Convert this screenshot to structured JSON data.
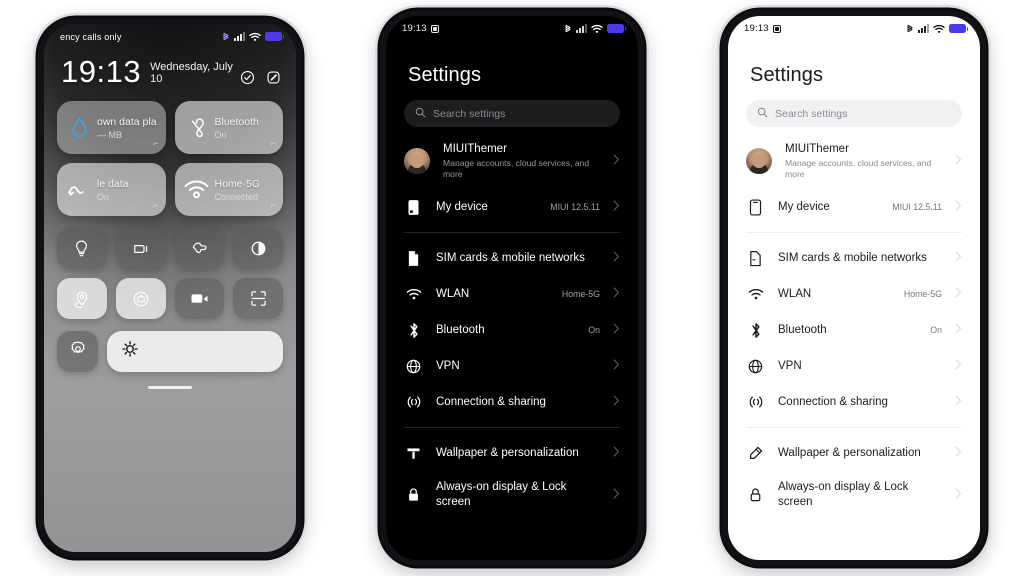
{
  "phone1": {
    "name": "control-center",
    "statusbar": {
      "carrier": "ency calls only",
      "icons": [
        "bluetooth-icon",
        "signal-icon",
        "wifi-icon",
        "battery-icon"
      ]
    },
    "clock": {
      "time": "19:13",
      "date": "Wednesday, July 10"
    },
    "header_icons": [
      "do-not-disturb-icon",
      "edit-icon"
    ],
    "big_tiles": [
      {
        "icon": "data-usage-icon",
        "title": "own data plan",
        "sub": "— MB",
        "state": "off"
      },
      {
        "icon": "bluetooth-icon",
        "title": "Bluetooth",
        "sub": "On",
        "state": "on"
      },
      {
        "icon": "mobile-data-icon",
        "title": "le data",
        "sub": "On",
        "state": "on"
      },
      {
        "icon": "wifi-icon",
        "title": "Home-5G",
        "sub": "Connected",
        "state": "on"
      }
    ],
    "tiles": [
      {
        "icon": "flashlight-icon",
        "state": "off"
      },
      {
        "icon": "vibrate-icon",
        "state": "off"
      },
      {
        "icon": "ringtone-icon",
        "state": "off"
      },
      {
        "icon": "dark-mode-icon",
        "state": "off"
      },
      {
        "icon": "location-icon",
        "state": "on"
      },
      {
        "icon": "screenshot-icon",
        "state": "on"
      },
      {
        "icon": "screen-recorder-icon",
        "state": "off"
      },
      {
        "icon": "scanner-icon",
        "state": "off"
      }
    ],
    "bottom": {
      "settings_icon": "settings-gear-icon",
      "brightness_icon": "brightness-icon"
    }
  },
  "phone2": {
    "name": "settings-dark",
    "statusbar": {
      "time": "19:13",
      "left_icon": "alarm-icon",
      "icons": [
        "bluetooth-icon",
        "signal-icon",
        "wifi-icon",
        "battery-icon"
      ]
    },
    "title": "Settings",
    "search": {
      "placeholder": "Search settings",
      "icon": "search-icon"
    },
    "rows": [
      {
        "icon": "avatar",
        "label": "MIUIThemer",
        "sub": "Manage accounts, cloud services, and more",
        "value": ""
      },
      {
        "icon": "my-device-icon",
        "label": "My device",
        "value": "MIUI 12.5.11"
      },
      {
        "icon": "sim-card-icon",
        "label": "SIM cards & mobile networks",
        "value": ""
      },
      {
        "icon": "wifi-icon",
        "label": "WLAN",
        "value": "Home-5G"
      },
      {
        "icon": "bluetooth-icon",
        "label": "Bluetooth",
        "value": "On"
      },
      {
        "icon": "vpn-icon",
        "label": "VPN",
        "value": ""
      },
      {
        "icon": "connection-sharing-icon",
        "label": "Connection & sharing",
        "value": ""
      },
      {
        "icon": "wallpaper-icon",
        "label": "Wallpaper & personalization",
        "value": ""
      },
      {
        "icon": "lock-icon",
        "label": "Always-on display & Lock screen",
        "value": ""
      }
    ]
  },
  "phone3": {
    "name": "settings-light",
    "statusbar": {
      "time": "19:13",
      "left_icon": "alarm-icon",
      "icons": [
        "bluetooth-icon",
        "signal-icon",
        "wifi-icon",
        "battery-icon"
      ]
    },
    "title": "Settings",
    "search": {
      "placeholder": "Search settings",
      "icon": "search-icon"
    },
    "rows": [
      {
        "icon": "avatar",
        "label": "MIUIThemer",
        "sub": "Manage accounts, cloud services, and more",
        "value": ""
      },
      {
        "icon": "my-device-icon",
        "label": "My device",
        "value": "MIUI 12.5.11"
      },
      {
        "icon": "sim-card-icon",
        "label": "SIM cards & mobile networks",
        "value": ""
      },
      {
        "icon": "wifi-icon",
        "label": "WLAN",
        "value": "Home-5G"
      },
      {
        "icon": "bluetooth-icon",
        "label": "Bluetooth",
        "value": "On"
      },
      {
        "icon": "vpn-icon",
        "label": "VPN",
        "value": ""
      },
      {
        "icon": "connection-sharing-icon",
        "label": "Connection & sharing",
        "value": ""
      },
      {
        "icon": "wallpaper-icon",
        "label": "Wallpaper & personalization",
        "value": ""
      },
      {
        "icon": "lock-icon",
        "label": "Always-on display & Lock screen",
        "value": ""
      }
    ]
  },
  "colors": {
    "battery": "#4d3ce6",
    "accent_water": "#3aa6e8",
    "dark_bg": "#000000",
    "light_bg": "#ffffff"
  }
}
